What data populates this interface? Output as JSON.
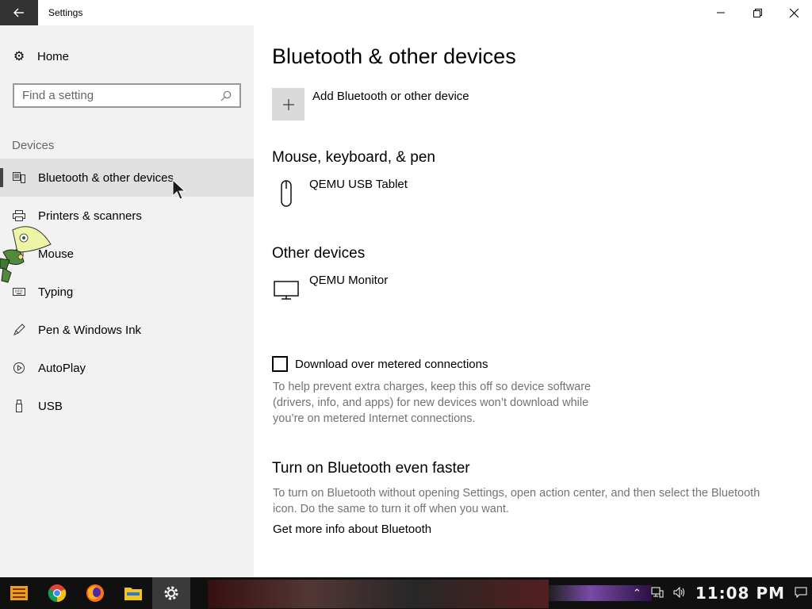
{
  "window": {
    "title": "Settings"
  },
  "sidebar": {
    "home_label": "Home",
    "search_placeholder": "Find a setting",
    "section_label": "Devices",
    "items": [
      {
        "label": "Bluetooth & other devices",
        "icon": "bluetooth-devices-icon",
        "active": true
      },
      {
        "label": "Printers & scanners",
        "icon": "printer-icon",
        "active": false
      },
      {
        "label": "Mouse",
        "icon": "mouse-icon",
        "active": false
      },
      {
        "label": "Typing",
        "icon": "keyboard-icon",
        "active": false
      },
      {
        "label": "Pen & Windows Ink",
        "icon": "pen-icon",
        "active": false
      },
      {
        "label": "AutoPlay",
        "icon": "autoplay-icon",
        "active": false
      },
      {
        "label": "USB",
        "icon": "usb-icon",
        "active": false
      }
    ]
  },
  "main": {
    "title": "Bluetooth & other devices",
    "add_device_label": "Add Bluetooth or other device",
    "mouse_section": "Mouse, keyboard, & pen",
    "mouse_device": "QEMU USB Tablet",
    "other_section": "Other devices",
    "other_device": "QEMU Monitor",
    "metered_label": "Download over metered connections",
    "metered_checked": false,
    "metered_desc_1": "To help prevent extra charges, keep this off so device software",
    "metered_desc_2": "(drivers, info, and apps) for new devices won’t download while",
    "metered_desc_3": "you’re on metered Internet connections.",
    "faster_title": "Turn on Bluetooth even faster",
    "faster_desc_1": "To turn on Bluetooth without opening Settings, open action center, and then select the Bluetooth",
    "faster_desc_2": "icon. Do the same to turn it off when you want.",
    "more_info_link": "Get more info about Bluetooth"
  },
  "taskbar": {
    "clock": "11:08 PM",
    "apps": [
      "start-icon",
      "chrome-icon",
      "firefox-icon",
      "file-explorer-icon",
      "settings-icon"
    ]
  },
  "colors": {
    "sidebar_bg": "#f2f2f2",
    "active_item_bg": "#e0e0e0",
    "back_button_bg": "#333333",
    "taskbar_bg": "#101010"
  }
}
